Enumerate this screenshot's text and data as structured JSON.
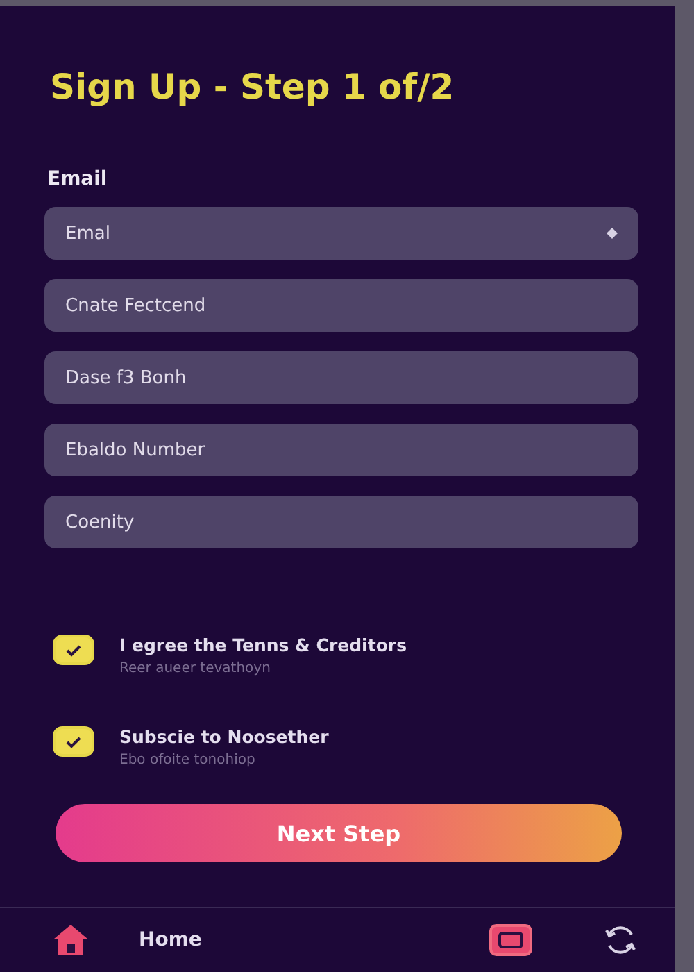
{
  "title": "Sign Up - Step 1 of/2",
  "form": {
    "label": "Email",
    "fields": [
      {
        "placeholder": "Emal",
        "trailing_icon": true
      },
      {
        "placeholder": "Cnate Fectcend",
        "trailing_icon": false
      },
      {
        "placeholder": "Dase f3 Bonh",
        "trailing_icon": false
      },
      {
        "placeholder": "Ebaldo Number",
        "trailing_icon": false
      },
      {
        "placeholder": "Coenity",
        "trailing_icon": false
      }
    ]
  },
  "checkboxes": [
    {
      "label": "I egree the Tenns & Creditors",
      "hint": "Reer aueer tevathoyn",
      "checked": true
    },
    {
      "label": "Subscie to Noosether",
      "hint": "Ebo ofoite tonohiop",
      "checked": true
    }
  ],
  "button": "Next Step",
  "nav": [
    {
      "kind": "home",
      "label": "Home"
    },
    {
      "kind": "media"
    },
    {
      "kind": "sync"
    }
  ]
}
